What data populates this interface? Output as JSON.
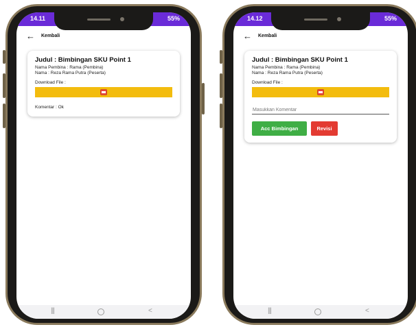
{
  "colors": {
    "status_bar": "#6a2bd8",
    "download_button": "#f3bc0e",
    "accept_button": "#3fae45",
    "revise_button": "#e33b32",
    "phone_frame": "#8a7a5c"
  },
  "left": {
    "status": {
      "time": "14.11",
      "battery": "55%"
    },
    "app_bar": {
      "back_icon": "arrow-left-icon",
      "title": "Kembali"
    },
    "card": {
      "title": "Judul : Bimbingan SKU Point 1",
      "pembina": "Nama Pembina : Rama (Pembina)",
      "peserta": "Nama  : Reza Rama Putra (Peserta)",
      "download_label": "Download File :",
      "download_icon": "pdf-file-icon",
      "comment": "Komentar : Ok"
    }
  },
  "right": {
    "status": {
      "time": "14.12",
      "battery": "55%"
    },
    "app_bar": {
      "back_icon": "arrow-left-icon",
      "title": "Kembali"
    },
    "card": {
      "title": "Judul : Bimbingan SKU Point 1",
      "pembina": "Nama Pembina : Rama (Pembina)",
      "peserta": "Nama  : Reza Rama Putra (Peserta)",
      "download_label": "Download File :",
      "download_icon": "pdf-file-icon",
      "comment_placeholder": "Masukkan Komentar",
      "accept_label": "Acc Bimbingan",
      "revise_label": "Revisi"
    }
  },
  "nav": {
    "recent_glyph": "|||",
    "back_glyph": "<"
  }
}
